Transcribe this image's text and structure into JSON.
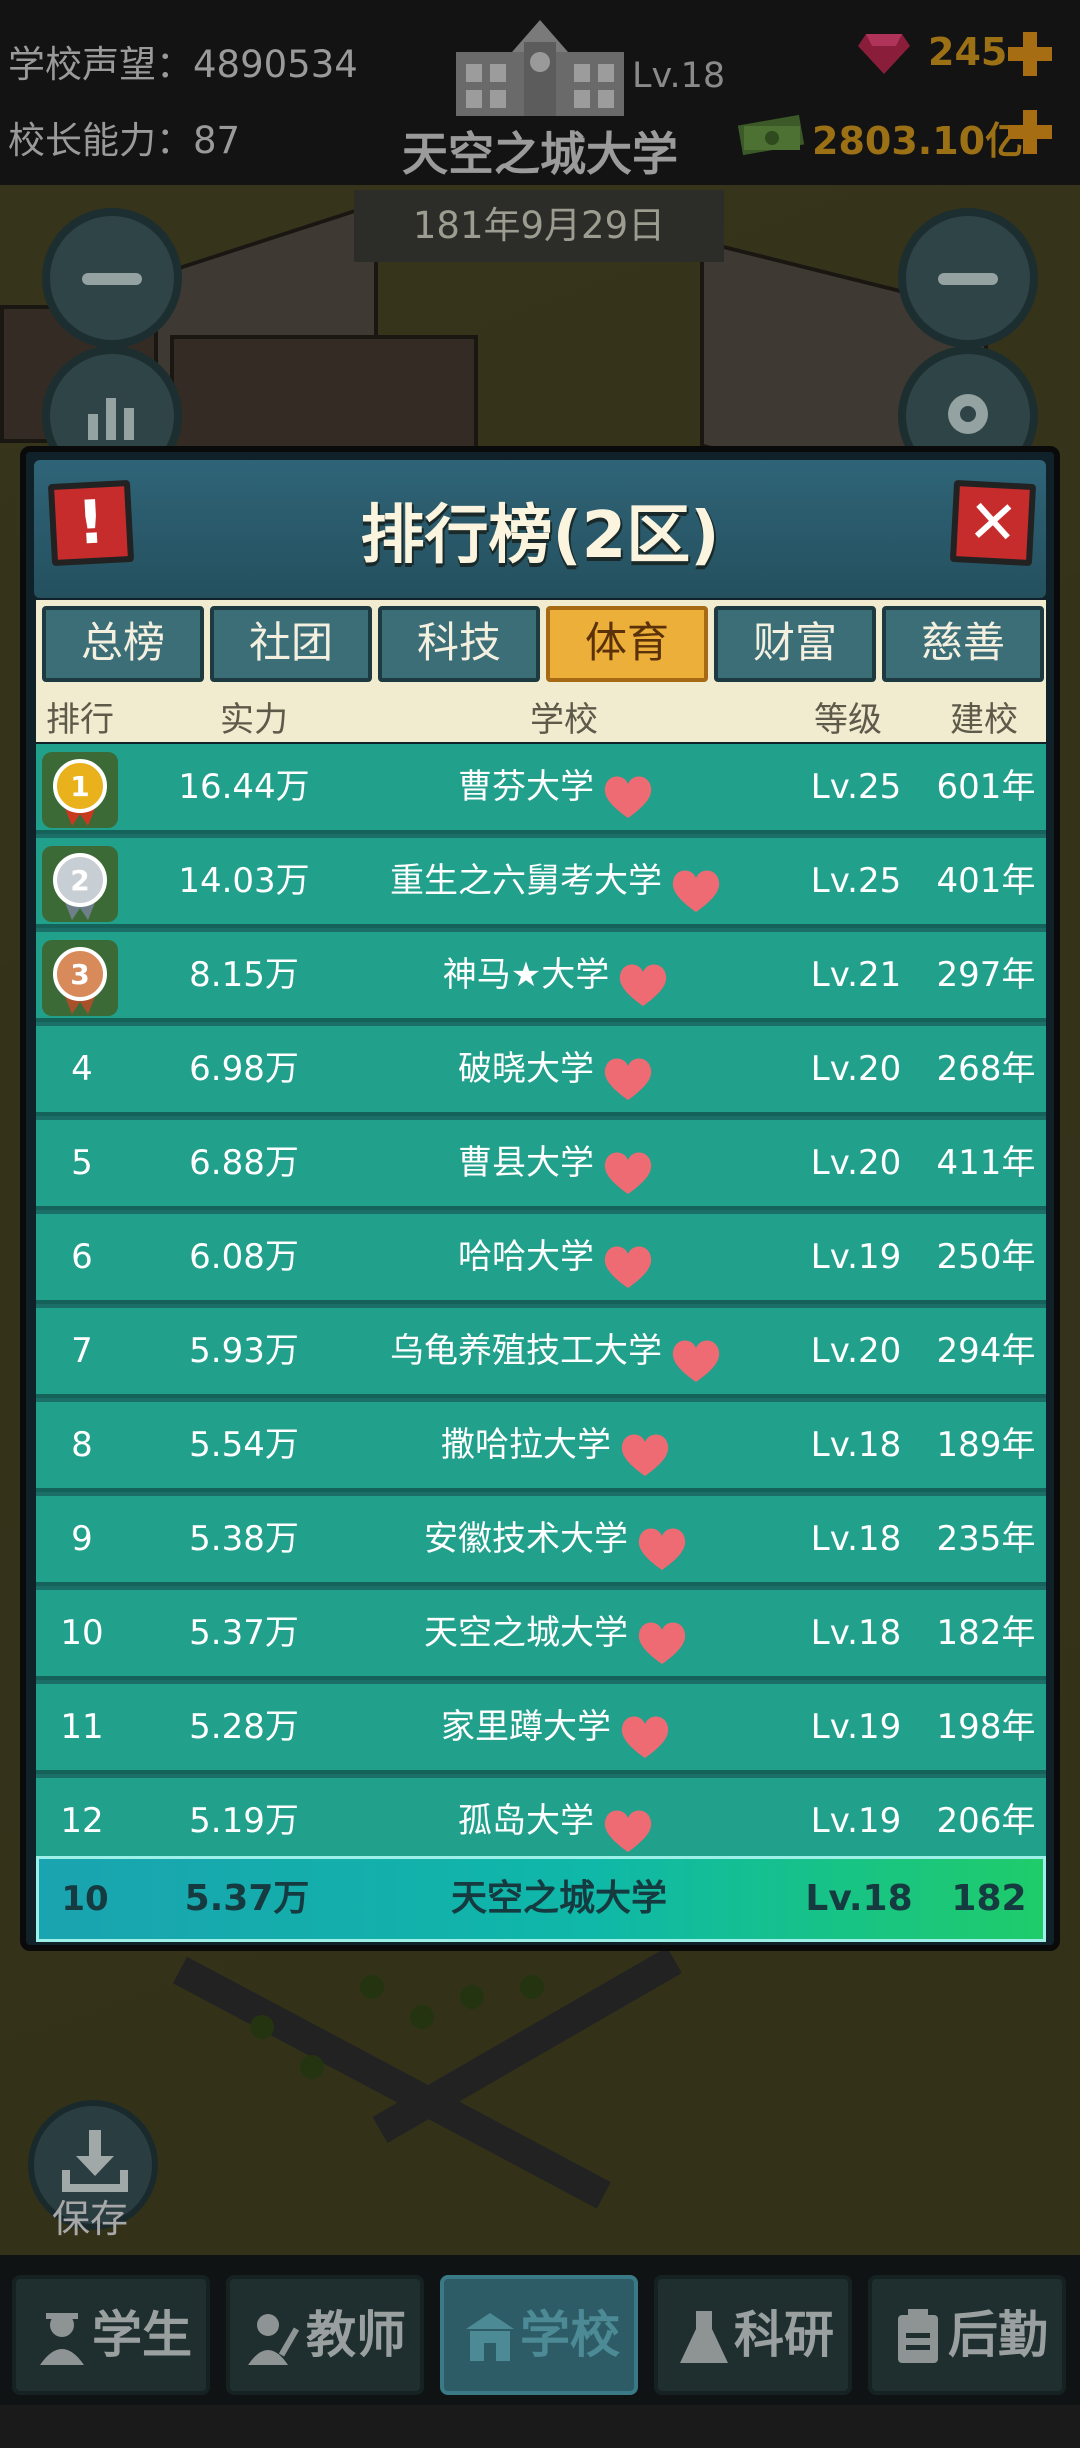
{
  "hud": {
    "reputation_label": "学校声望：",
    "reputation_value": "4890534",
    "ability_label": "校长能力：",
    "ability_value": "87",
    "school_level": "Lv.18",
    "school_name": "天空之城大学",
    "date": "181年9月29日",
    "gems": "245",
    "money": "2803.10亿"
  },
  "modal": {
    "title": "排行榜(2区)",
    "tabs": [
      "总榜",
      "社团",
      "科技",
      "体育",
      "财富",
      "慈善"
    ],
    "active_tab": "体育",
    "columns": [
      "排行",
      "实力",
      "学校",
      "等级",
      "建校"
    ],
    "rows": [
      {
        "rank": "1",
        "power": "16.44万",
        "school": "曹芬大学",
        "level": "Lv.25",
        "age": "601年"
      },
      {
        "rank": "2",
        "power": "14.03万",
        "school": "重生之六舅考大学",
        "level": "Lv.25",
        "age": "401年"
      },
      {
        "rank": "3",
        "power": "8.15万",
        "school": "神马★大学",
        "level": "Lv.21",
        "age": "297年"
      },
      {
        "rank": "4",
        "power": "6.98万",
        "school": "破晓大学",
        "level": "Lv.20",
        "age": "268年"
      },
      {
        "rank": "5",
        "power": "6.88万",
        "school": "曹县大学",
        "level": "Lv.20",
        "age": "411年"
      },
      {
        "rank": "6",
        "power": "6.08万",
        "school": "哈哈大学",
        "level": "Lv.19",
        "age": "250年"
      },
      {
        "rank": "7",
        "power": "5.93万",
        "school": "乌龟养殖技工大学",
        "level": "Lv.20",
        "age": "294年"
      },
      {
        "rank": "8",
        "power": "5.54万",
        "school": "撒哈拉大学",
        "level": "Lv.18",
        "age": "189年"
      },
      {
        "rank": "9",
        "power": "5.38万",
        "school": "安徽技术大学",
        "level": "Lv.18",
        "age": "235年"
      },
      {
        "rank": "10",
        "power": "5.37万",
        "school": "天空之城大学",
        "level": "Lv.18",
        "age": "182年"
      },
      {
        "rank": "11",
        "power": "5.28万",
        "school": "家里蹲大学",
        "level": "Lv.19",
        "age": "198年"
      },
      {
        "rank": "12",
        "power": "5.19万",
        "school": "孤岛大学",
        "level": "Lv.19",
        "age": "206年"
      }
    ],
    "my_row": {
      "rank": "10",
      "power": "5.37万",
      "school": "天空之城大学",
      "level": "Lv.18",
      "age": "182"
    }
  },
  "save_label": "保存",
  "nav": [
    "学生",
    "教师",
    "学校",
    "科研",
    "后勤"
  ],
  "active_nav": "学校",
  "colors": {
    "accent_tab": "#ecb03a",
    "row_bg": "#21a08c",
    "heart": "#ef6b73",
    "my_row_start": "#1aa3b0",
    "my_row_end": "#1fcc6a"
  }
}
